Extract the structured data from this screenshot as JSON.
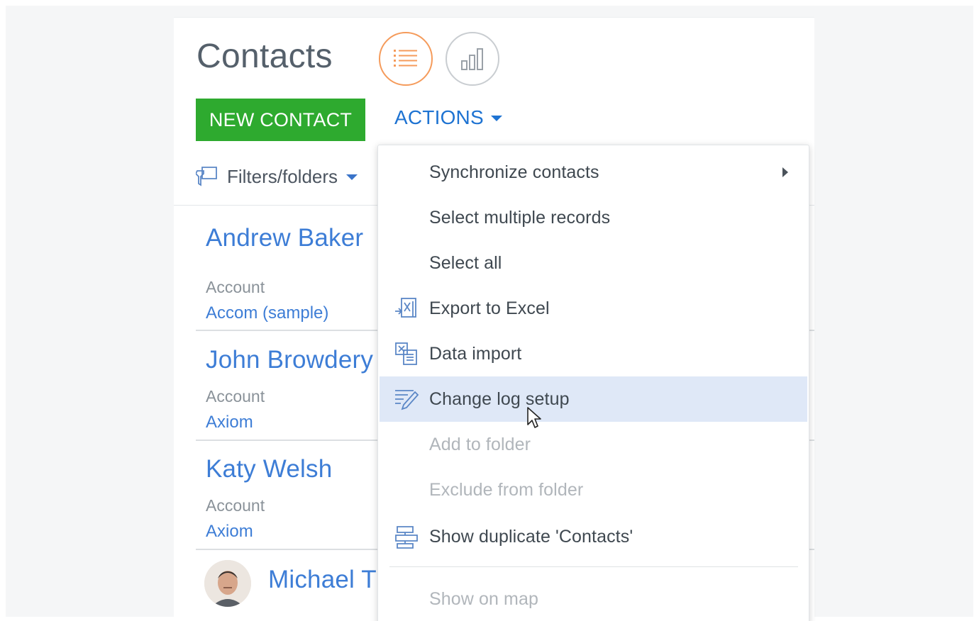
{
  "header": {
    "title": "Contacts",
    "list_view_icon": "list-icon",
    "analytics_view_icon": "bar-chart-icon"
  },
  "toolbar": {
    "new_contact_label": "NEW CONTACT",
    "actions_label": "ACTIONS"
  },
  "filters": {
    "label": "Filters/folders",
    "icon": "filter-folder-icon"
  },
  "contacts": [
    {
      "name": "Andrew Baker",
      "account_label": "Account",
      "account_value": "Accom (sample)"
    },
    {
      "name": "John Browdery",
      "account_label": "Account",
      "account_value": "Axiom"
    },
    {
      "name": "Katy Welsh",
      "account_label": "Account",
      "account_value": "Axiom"
    },
    {
      "name": "Michael T"
    }
  ],
  "actions_menu": {
    "items": [
      {
        "label": "Synchronize contacts",
        "has_submenu": true
      },
      {
        "label": "Select multiple records"
      },
      {
        "label": "Select all"
      },
      {
        "label": "Export to Excel",
        "icon": "export-excel-icon"
      },
      {
        "label": "Data import",
        "icon": "data-import-icon"
      },
      {
        "label": "Change log setup",
        "icon": "change-log-icon",
        "hovered": true
      },
      {
        "label": "Add to folder",
        "disabled": true
      },
      {
        "label": "Exclude from folder",
        "disabled": true
      },
      {
        "label": "Show duplicate 'Contacts'",
        "icon": "duplicates-icon"
      },
      {
        "label": "Show on map",
        "disabled": true
      }
    ]
  },
  "colors": {
    "accent_green": "#2eaa2f",
    "link_blue": "#3d7dd6",
    "actions_blue": "#1e73d2",
    "active_view_orange": "#f59b5b",
    "hover_bg": "#dfe8f7"
  }
}
